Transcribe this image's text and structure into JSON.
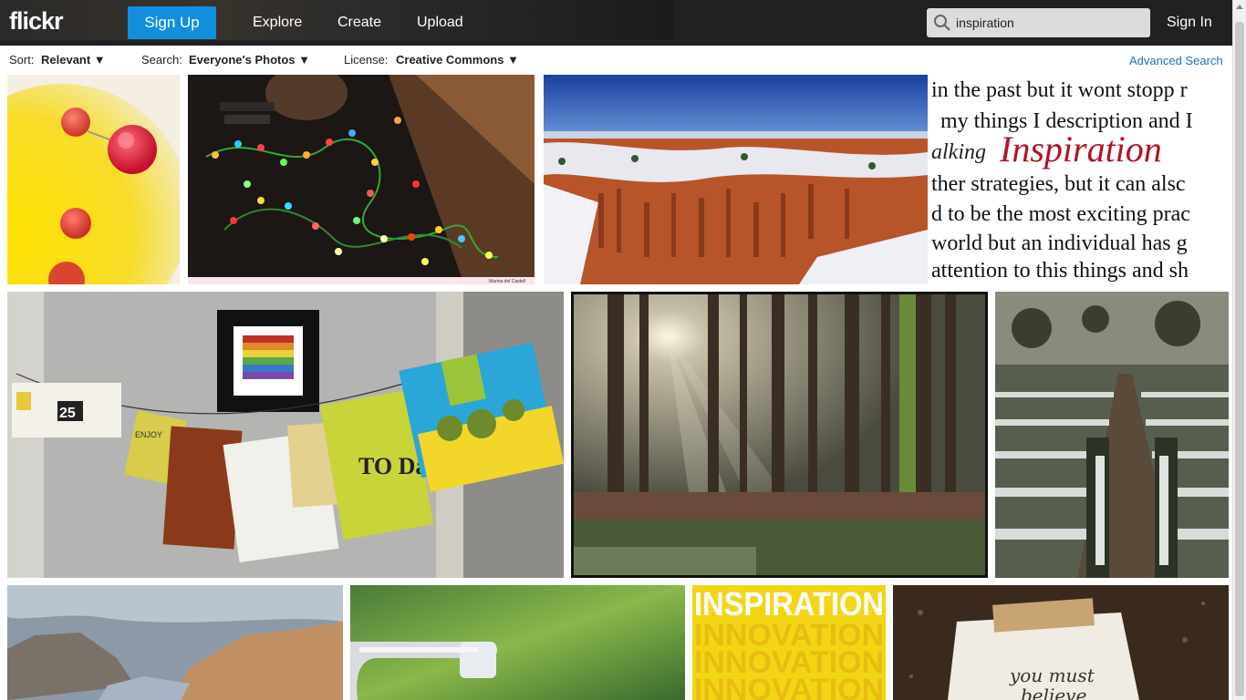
{
  "header": {
    "logo": "flickr",
    "signup": "Sign Up",
    "nav": [
      "Explore",
      "Create",
      "Upload"
    ],
    "search_value": "inspiration",
    "signin": "Sign In"
  },
  "filters": {
    "sort_label": "Sort:",
    "sort_value": "Relevant ▼",
    "search_label": "Search:",
    "search_value": "Everyone's Photos ▼",
    "license_label": "License:",
    "license_value": "Creative Commons ▼",
    "advanced": "Advanced Search"
  },
  "photos": {
    "lights_credit": "Marina del Castell",
    "text_lines": [
      "in the past but it wont stopp r",
      "my things I description and I",
      "alking",
      "Inspiration",
      "ther strategies, but it can alsc",
      "d to be the most exciting prac",
      "world but an individual has g",
      "attention to this things and sh"
    ],
    "today_card": "TO Day",
    "enjoy_card": "ENJOY",
    "counter": "25",
    "banner_lines": [
      "INSPIRATION",
      "INNOVATION",
      "INNOVATION",
      "INNOVATION"
    ],
    "note_lines": [
      "you must",
      "believe"
    ]
  }
}
